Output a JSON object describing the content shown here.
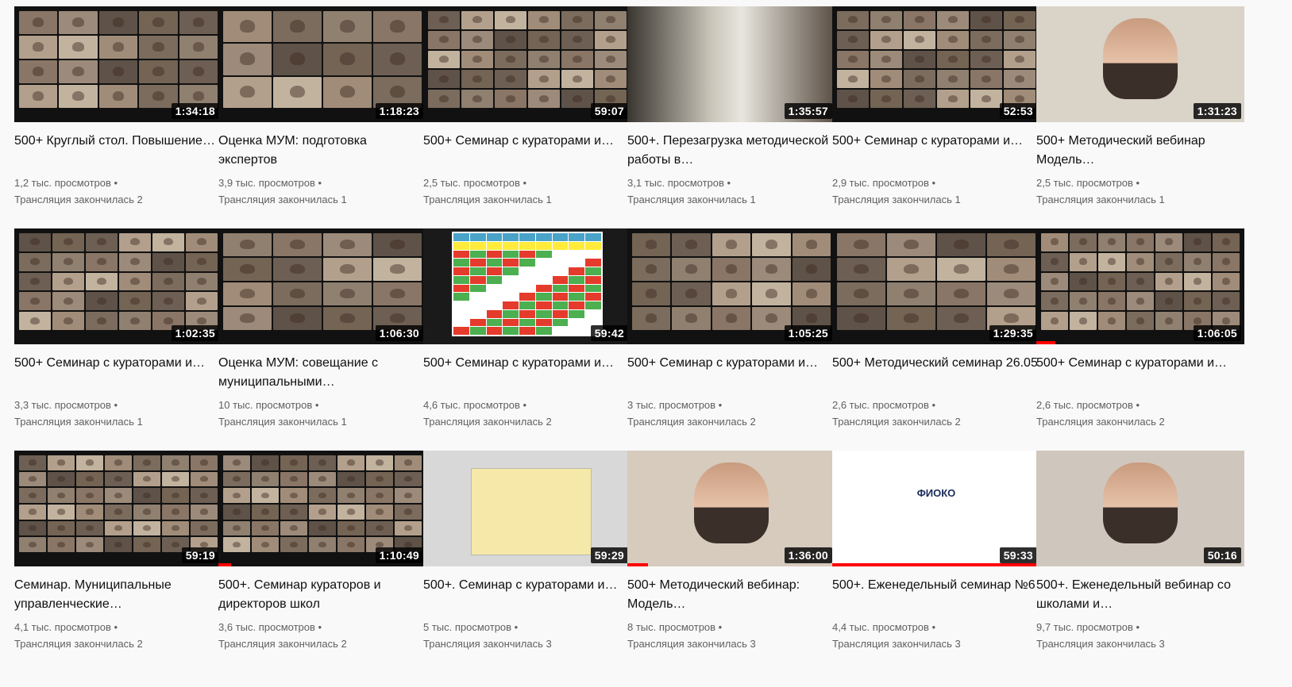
{
  "videos": [
    {
      "title": "500+ Круглый стол. Повышение…",
      "views": "1,2 тыс. просмотров •",
      "ago": "Трансляция закончилась 2",
      "duration": "1:34:18",
      "kind": "grid",
      "cols": 5,
      "rows": 4,
      "color": "#6b5a4a"
    },
    {
      "title": "Оценка МУМ: подготовка экспертов",
      "views": "3,9 тыс. просмотров •",
      "ago": "Трансляция закончилась 1",
      "duration": "1:18:23",
      "kind": "grid",
      "cols": 4,
      "rows": 3,
      "color": "#8c7a66"
    },
    {
      "title": "500+ Семинар с кураторами и…",
      "views": "2,5 тыс. просмотров •",
      "ago": "Трансляция закончилась 1",
      "duration": "59:07",
      "kind": "grid",
      "cols": 6,
      "rows": 5,
      "color": "#7a6a58"
    },
    {
      "title": "500+. Перезагрузка методической работы в…",
      "views": "3,1 тыс. просмотров •",
      "ago": "Трансляция закончилась 1",
      "duration": "1:35:57",
      "kind": "room",
      "color": "#a89a84"
    },
    {
      "title": "500+ Семинар с кураторами и…",
      "views": "2,9 тыс. просмотров •",
      "ago": "Трансляция закончилась 1",
      "duration": "52:53",
      "kind": "grid",
      "cols": 6,
      "rows": 5,
      "color": "#6e6250"
    },
    {
      "title": "500+ Методический вебинар Модель…",
      "views": "2,5 тыс. просмотров •",
      "ago": "Трансляция закончилась 1",
      "duration": "1:31:23",
      "kind": "face",
      "color": "#d9d3c8"
    },
    {
      "title": "500+ Семинар с кураторами и…",
      "views": "3,3 тыс. просмотров •",
      "ago": "Трансляция закончилась 1",
      "duration": "1:02:35",
      "kind": "grid",
      "cols": 6,
      "rows": 5,
      "color": "#6f5f50"
    },
    {
      "title": "Оценка МУМ: совещание с муниципальными…",
      "views": "10 тыс. просмотров •",
      "ago": "Трансляция закончилась 1",
      "duration": "1:06:30",
      "kind": "grid",
      "cols": 4,
      "rows": 4,
      "color": "#80705e"
    },
    {
      "title": "500+ Семинар с кураторами и…",
      "views": "4,6 тыс. просмотров •",
      "ago": "Трансляция закончилась 2",
      "duration": "59:42",
      "kind": "table",
      "color": "#e84a3a"
    },
    {
      "title": "500+ Семинар с кураторами и…",
      "views": "3 тыс. просмотров •",
      "ago": "Трансляция закончилась 2",
      "duration": "1:05:25",
      "kind": "grid",
      "cols": 5,
      "rows": 4,
      "color": "#776652"
    },
    {
      "title": "500+ Методический семинар 26.05",
      "views": "2,6 тыс. просмотров •",
      "ago": "Трансляция закончилась 2",
      "duration": "1:29:35",
      "kind": "grid",
      "cols": 4,
      "rows": 4,
      "color": "#7d8a6a"
    },
    {
      "title": "500+ Семинар с кураторами и…",
      "views": "2,6 тыс. просмотров •",
      "ago": "Трансляция закончилась 2",
      "duration": "1:06:05",
      "kind": "grid",
      "cols": 7,
      "rows": 5,
      "color": "#6a5c4e",
      "progress": 0.09
    },
    {
      "title": "Семинар. Муниципальные управленческие…",
      "views": "4,1 тыс. просмотров •",
      "ago": "Трансляция закончилась 2",
      "duration": "59:19",
      "kind": "grid",
      "cols": 7,
      "rows": 6,
      "color": "#706250"
    },
    {
      "title": "500+. Семинар кураторов и директоров школ",
      "views": "3,6 тыс. просмотров •",
      "ago": "Трансляция закончилась 2",
      "duration": "1:10:49",
      "kind": "grid",
      "cols": 7,
      "rows": 6,
      "color": "#6c5e4c",
      "progress": 0.06
    },
    {
      "title": "500+. Семинар с кураторами и…",
      "views": "5 тыс. просмотров •",
      "ago": "Трансляция закончилась 3",
      "duration": "59:29",
      "kind": "doc",
      "color": "#f2e6b0"
    },
    {
      "title": "500+ Методический вебинар: Модель…",
      "views": "8 тыс. просмотров •",
      "ago": "Трансляция закончилась 3",
      "duration": "1:36:00",
      "kind": "face",
      "color": "#d6cbbd",
      "progress": 0.1
    },
    {
      "title": "500+. Еженедельный семинар №6",
      "views": "4,4 тыс. просмотров •",
      "ago": "Трансляция закончилась 3",
      "duration": "59:33",
      "kind": "slide",
      "color": "#ffffff",
      "progress": 1.0,
      "slide_logo": "ФИОКО"
    },
    {
      "title": "500+. Еженедельный вебинар со школами и…",
      "views": "9,7 тыс. просмотров •",
      "ago": "Трансляция закончилась 3",
      "duration": "50:16",
      "kind": "face",
      "color": "#cfc7bd"
    }
  ]
}
